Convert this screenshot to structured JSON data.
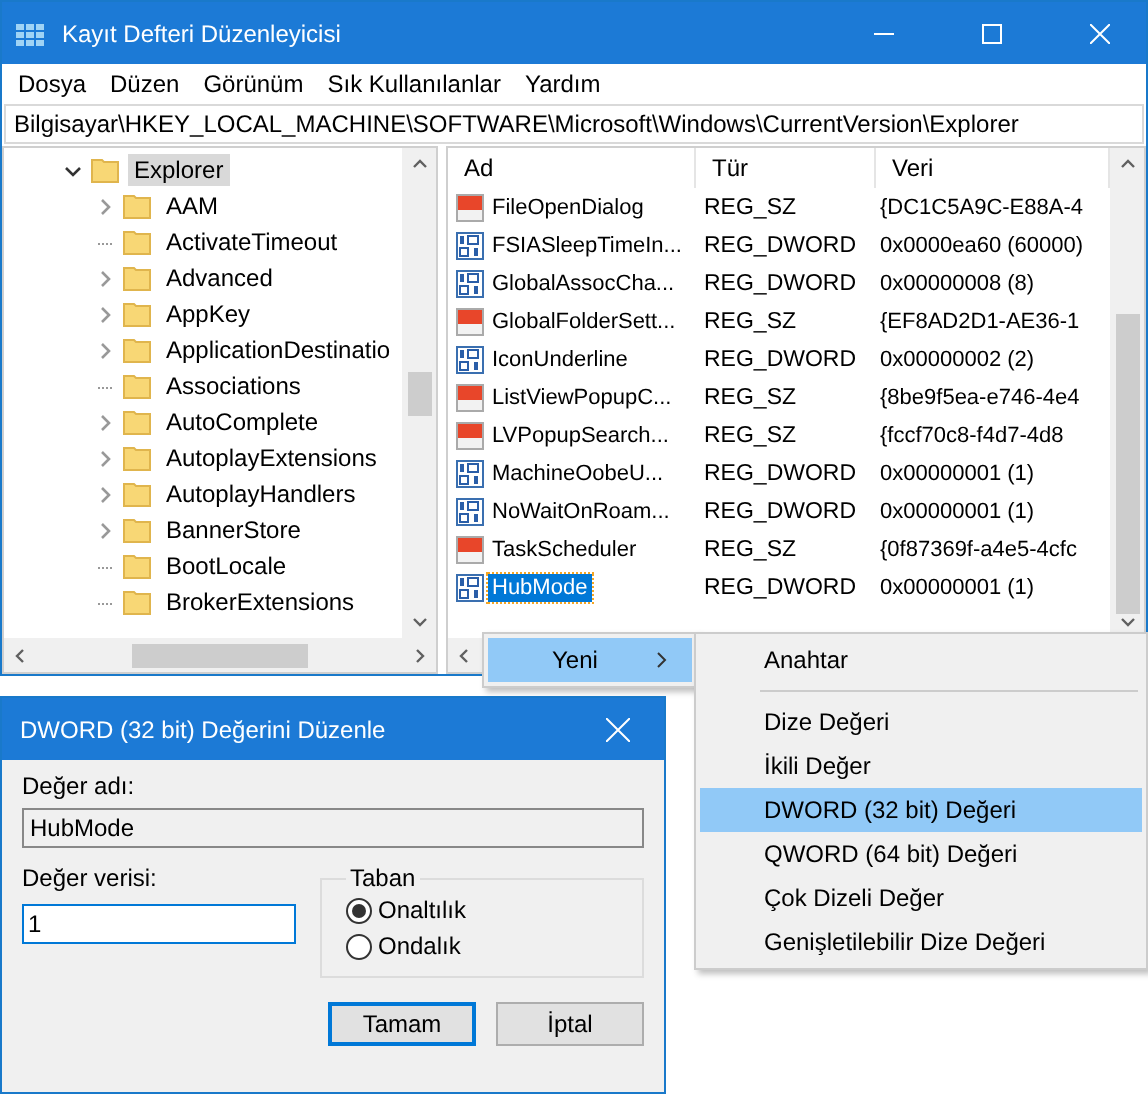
{
  "window": {
    "title": "Kayıt Defteri Düzenleyicisi"
  },
  "menu": [
    "Dosya",
    "Düzen",
    "Görünüm",
    "Sık Kullanılanlar",
    "Yardım"
  ],
  "address": "Bilgisayar\\HKEY_LOCAL_MACHINE\\SOFTWARE\\Microsoft\\Windows\\CurrentVersion\\Explorer",
  "tree": {
    "label": "Explorer",
    "selected": true,
    "expanded": true,
    "children": [
      {
        "label": "AAM",
        "has_children": true
      },
      {
        "label": "ActivateTimeout",
        "has_children": false
      },
      {
        "label": "Advanced",
        "has_children": true
      },
      {
        "label": "AppKey",
        "has_children": true
      },
      {
        "label": "ApplicationDestinatio",
        "has_children": true
      },
      {
        "label": "Associations",
        "has_children": false
      },
      {
        "label": "AutoComplete",
        "has_children": true
      },
      {
        "label": "AutoplayExtensions",
        "has_children": true
      },
      {
        "label": "AutoplayHandlers",
        "has_children": true
      },
      {
        "label": "BannerStore",
        "has_children": true
      },
      {
        "label": "BootLocale",
        "has_children": false
      },
      {
        "label": "BrokerExtensions",
        "has_children": false
      }
    ]
  },
  "values": {
    "columns": [
      "Ad",
      "Tür",
      "Veri"
    ],
    "rows": [
      {
        "kind": "string",
        "name": "FileOpenDialog",
        "type": "REG_SZ",
        "data": "{DC1C5A9C-E88A-4",
        "selected": false
      },
      {
        "kind": "dword",
        "name": "FSIASleepTimeIn...",
        "type": "REG_DWORD",
        "data": "0x0000ea60 (60000)",
        "selected": false
      },
      {
        "kind": "dword",
        "name": "GlobalAssocCha...",
        "type": "REG_DWORD",
        "data": "0x00000008 (8)",
        "selected": false
      },
      {
        "kind": "string",
        "name": "GlobalFolderSett...",
        "type": "REG_SZ",
        "data": "{EF8AD2D1-AE36-1",
        "selected": false
      },
      {
        "kind": "dword",
        "name": "IconUnderline",
        "type": "REG_DWORD",
        "data": "0x00000002 (2)",
        "selected": false
      },
      {
        "kind": "string",
        "name": "ListViewPopupC...",
        "type": "REG_SZ",
        "data": "{8be9f5ea-e746-4e4",
        "selected": false
      },
      {
        "kind": "string",
        "name": "LVPopupSearch...",
        "type": "REG_SZ",
        "data": "{fccf70c8-f4d7-4d8",
        "selected": false
      },
      {
        "kind": "dword",
        "name": "MachineOobeU...",
        "type": "REG_DWORD",
        "data": "0x00000001 (1)",
        "selected": false
      },
      {
        "kind": "dword",
        "name": "NoWaitOnRoam...",
        "type": "REG_DWORD",
        "data": "0x00000001 (1)",
        "selected": false
      },
      {
        "kind": "string",
        "name": "TaskScheduler",
        "type": "REG_SZ",
        "data": "{0f87369f-a4e5-4cfc",
        "selected": false
      },
      {
        "kind": "dword",
        "name": "HubMode",
        "type": "REG_DWORD",
        "data": "0x00000001 (1)",
        "selected": true
      }
    ]
  },
  "context_menu": {
    "items": [
      {
        "label": "Yeni",
        "selected": true
      }
    ]
  },
  "submenu": {
    "items": [
      {
        "kind": "item",
        "label": "Anahtar",
        "selected": false
      },
      {
        "kind": "separator"
      },
      {
        "kind": "item",
        "label": "Dize Değeri",
        "selected": false
      },
      {
        "kind": "item",
        "label": "İkili Değer",
        "selected": false
      },
      {
        "kind": "item",
        "label": "DWORD (32 bit) Değeri",
        "selected": true
      },
      {
        "kind": "item",
        "label": "QWORD (64 bit) Değeri",
        "selected": false
      },
      {
        "kind": "item",
        "label": "Çok Dizeli Değer",
        "selected": false
      },
      {
        "kind": "item",
        "label": "Genişletilebilir Dize Değeri",
        "selected": false
      }
    ]
  },
  "dialog": {
    "title": "DWORD (32 bit) Değerini Düzenle",
    "name_label": "Değer adı:",
    "name_value": "HubMode",
    "data_label": "Değer verisi:",
    "data_value": "1",
    "base": {
      "title": "Taban",
      "options": [
        {
          "label": "Onaltılık",
          "selected": true
        },
        {
          "label": "Ondalık",
          "selected": false
        }
      ]
    },
    "buttons": [
      "Tamam",
      "İptal"
    ]
  }
}
